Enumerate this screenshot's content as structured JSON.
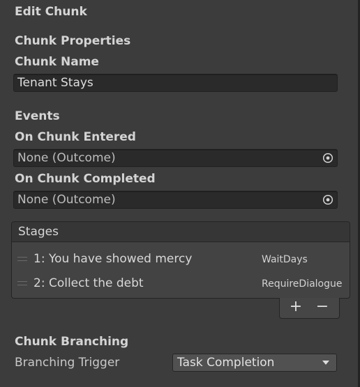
{
  "inspector": {
    "title": "Edit Chunk",
    "properties_header": "Chunk Properties",
    "chunk_name_label": "Chunk Name",
    "chunk_name_value": "Tenant Stays",
    "events_header": "Events",
    "on_entered_label": "On Chunk Entered",
    "on_entered_value": "None (Outcome)",
    "on_completed_label": "On Chunk Completed",
    "on_completed_value": "None (Outcome)"
  },
  "stages": {
    "header": "Stages",
    "items": [
      {
        "label": "1: You have showed mercy",
        "type": "WaitDays"
      },
      {
        "label": "2: Collect the debt",
        "type": "RequireDialogue"
      }
    ],
    "add_label": "+",
    "remove_label": "−"
  },
  "branching": {
    "header": "Chunk Branching",
    "trigger_label": "Branching Trigger",
    "trigger_value": "Task Completion"
  },
  "icons": {
    "object_picker": "object-picker-icon",
    "drag_handle": "drag-handle-icon",
    "dropdown_arrow": "dropdown-arrow-icon"
  },
  "colors": {
    "background": "#3c3c3c",
    "field_background": "#2a2a2a",
    "list_header": "#363636",
    "dropdown_background": "#515151"
  }
}
